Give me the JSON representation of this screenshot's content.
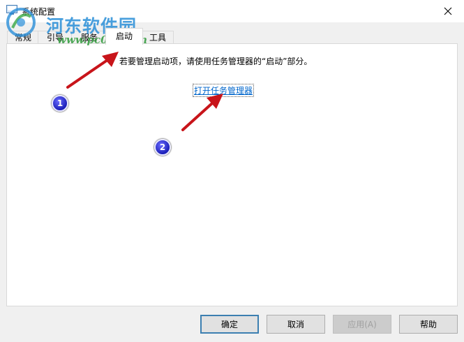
{
  "window": {
    "title": "系统配置",
    "close_icon": "close-icon"
  },
  "watermark": {
    "title": "河东软件园",
    "url": "www.pc0359.cn"
  },
  "tabs": [
    {
      "label": "常规",
      "active": false
    },
    {
      "label": "引导",
      "active": false
    },
    {
      "label": "服务",
      "active": false
    },
    {
      "label": "启动",
      "active": true
    },
    {
      "label": "工具",
      "active": false
    }
  ],
  "panel": {
    "info": "若要管理启动项，请使用任务管理器的“启动”部分。",
    "link": "打开任务管理器"
  },
  "annotations": {
    "badge1": "1",
    "badge2": "2",
    "arrow_color": "#d9191f"
  },
  "buttons": {
    "ok": "确定",
    "cancel": "取消",
    "apply": "应用(A)",
    "help": "帮助"
  }
}
